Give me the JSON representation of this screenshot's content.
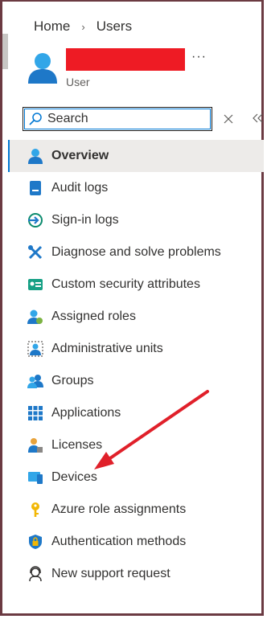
{
  "breadcrumb": {
    "home": "Home",
    "separator": "›",
    "current": "Users"
  },
  "user": {
    "role": "User",
    "more": "···"
  },
  "search": {
    "placeholder": "Search"
  },
  "nav": [
    {
      "label": "Overview",
      "icon": "user-icon",
      "active": true
    },
    {
      "label": "Audit logs",
      "icon": "audit-log-icon"
    },
    {
      "label": "Sign-in logs",
      "icon": "sign-in-icon"
    },
    {
      "label": "Diagnose and solve problems",
      "icon": "wrench-icon"
    },
    {
      "label": "Custom security attributes",
      "icon": "security-attributes-icon"
    },
    {
      "label": "Assigned roles",
      "icon": "assigned-roles-icon"
    },
    {
      "label": "Administrative units",
      "icon": "admin-units-icon"
    },
    {
      "label": "Groups",
      "icon": "groups-icon"
    },
    {
      "label": "Applications",
      "icon": "applications-icon"
    },
    {
      "label": "Licenses",
      "icon": "licenses-icon"
    },
    {
      "label": "Devices",
      "icon": "devices-icon"
    },
    {
      "label": "Azure role assignments",
      "icon": "key-icon"
    },
    {
      "label": "Authentication methods",
      "icon": "shield-lock-icon"
    },
    {
      "label": "New support request",
      "icon": "support-icon"
    }
  ],
  "colors": {
    "accent": "#0078d4",
    "redaction": "#ee1b24",
    "annotation_arrow": "#e0202a",
    "frame": "#6b3a42"
  }
}
